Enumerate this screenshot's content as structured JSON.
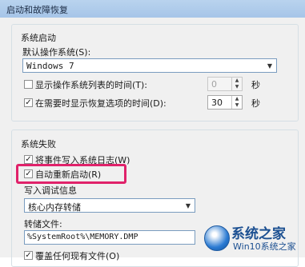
{
  "window": {
    "title": "启动和故障恢复"
  },
  "system_startup": {
    "group_label": "系统启动",
    "default_os_label": "默认操作系统(S):",
    "default_os_value": "Windows 7",
    "show_os_list": {
      "label": "显示操作系统列表的时间(T):",
      "checked": false,
      "value": "0",
      "unit": "秒"
    },
    "show_recovery": {
      "label": "在需要时显示恢复选项的时间(D):",
      "checked": true,
      "value": "30",
      "unit": "秒"
    }
  },
  "system_failure": {
    "group_label": "系统失败",
    "write_event_log": {
      "label": "将事件写入系统日志(W)",
      "checked": true
    },
    "auto_restart": {
      "label": "自动重新启动(R)",
      "checked": true
    },
    "debug_info_label": "写入调试信息",
    "debug_info_value": "核心内存转储",
    "dump_file_label": "转储文件:",
    "dump_file_value": "%SystemRoot%\\MEMORY.DMP",
    "overwrite": {
      "label": "覆盖任何现有文件(O)",
      "checked": true
    }
  },
  "watermark": {
    "title": "系统之家",
    "subtitle": "Win10系统之家"
  },
  "colors": {
    "highlight": "#e0226a",
    "titlebar": "#a6c5e8",
    "panel": "#f0f0f0"
  }
}
